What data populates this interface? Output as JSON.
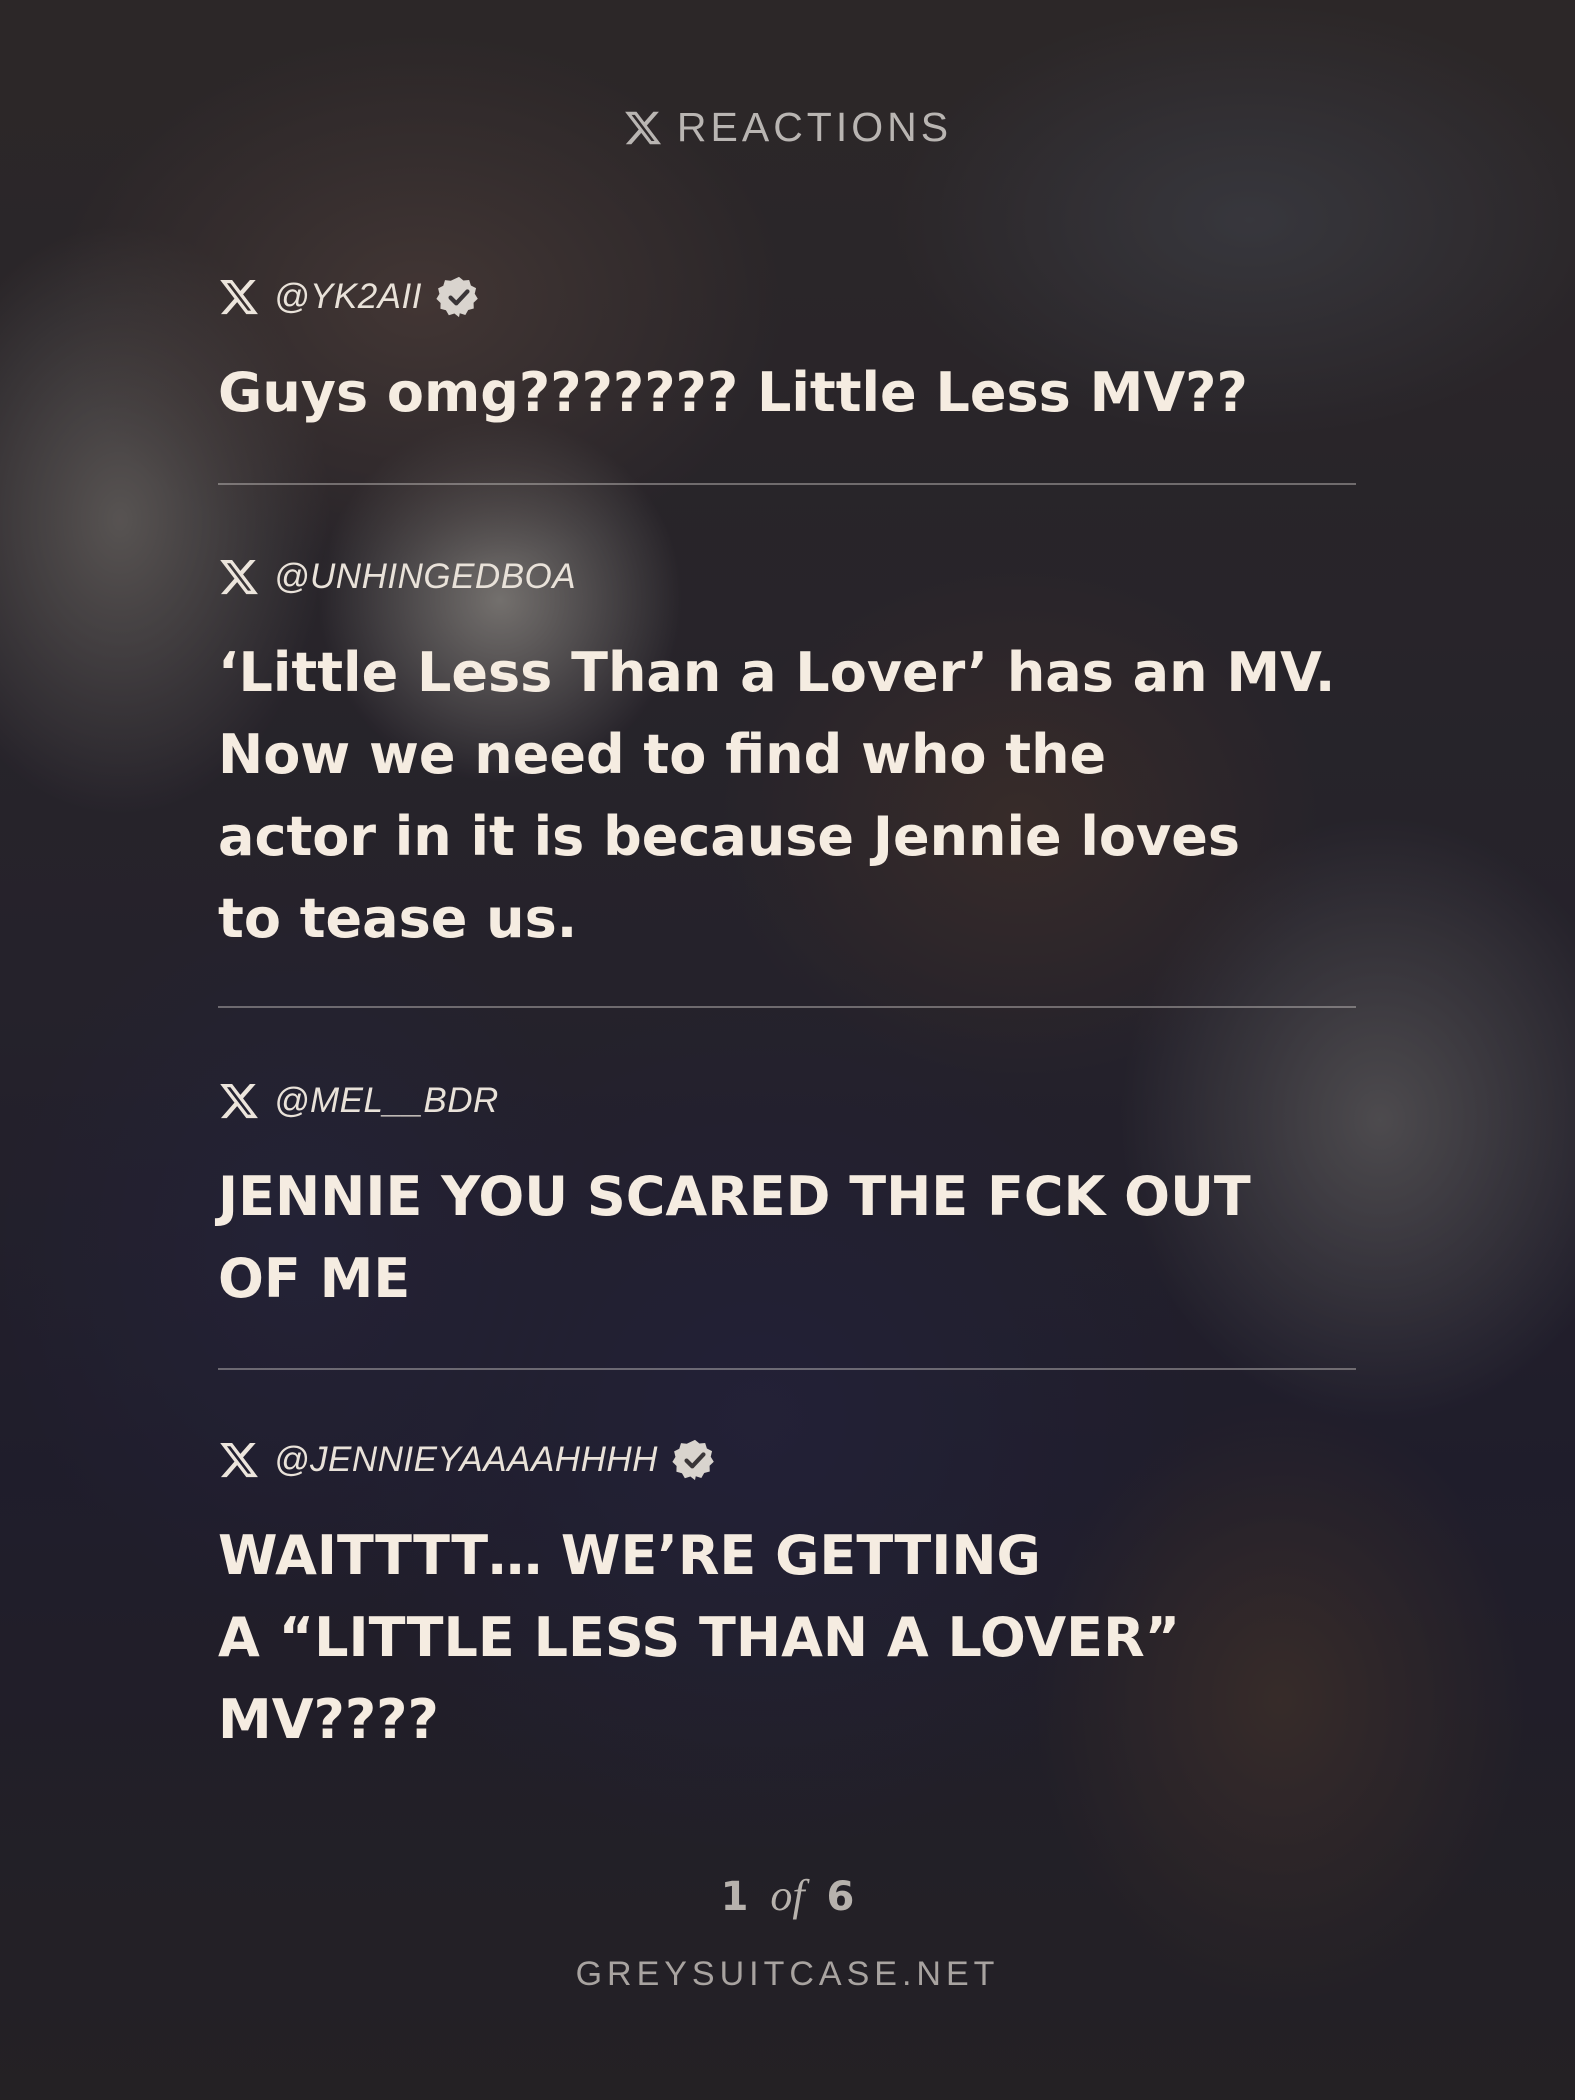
{
  "header": {
    "icon": "x-logo-icon",
    "label": "REACTIONS"
  },
  "tweets": [
    {
      "handle": "@YK2AII",
      "verified": true,
      "text": "Guys omg??????? Little Less MV??"
    },
    {
      "handle": "@UNHINGEDBOA",
      "verified": false,
      "text": "‘Little Less Than a Lover’ has an MV.\nNow we need to find who the\nactor in it is because Jennie loves\nto tease us."
    },
    {
      "handle": "@MEL__BDR",
      "verified": false,
      "text": "JENNIE YOU SCARED THE FCK OUT\nOF ME"
    },
    {
      "handle": "@JENNIEYAAAAHHHH",
      "verified": true,
      "text": "WAITTTT… WE’RE GETTING\nA “LITTLE LESS THAN A LOVER”\nMV????"
    }
  ],
  "pagination": {
    "current": "1",
    "of": "of",
    "total": "6"
  },
  "footer": {
    "site": "GREYSUITCASE.NET"
  },
  "colors": {
    "text": "#f5ece1",
    "muted": "#b7b2ad",
    "divider": "#c8c4c0"
  }
}
